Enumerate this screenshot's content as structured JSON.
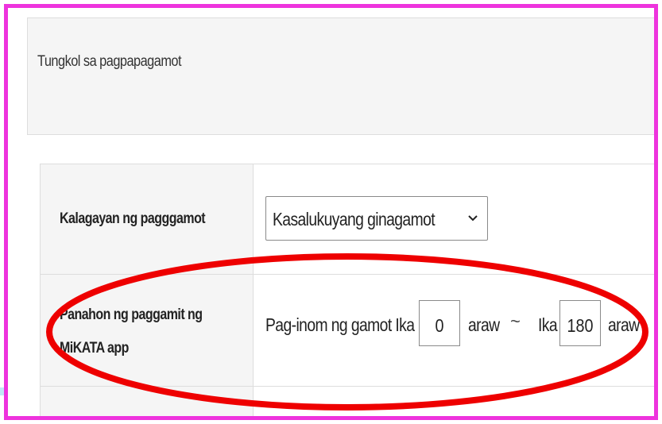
{
  "panel": {
    "title": "Tungkol sa pagpapagamot"
  },
  "rows": [
    {
      "label": "Kalagayan ng pagggamot",
      "select_value": "Kasalukuyang ginagamot"
    },
    {
      "label_line1": "Panahon ng paggamit ng",
      "label_line2": "MiKATA app",
      "prefix": "Pag-inom ng gamot Ika",
      "start_day": "0",
      "unit1": "araw",
      "separator": "~",
      "mid_prefix": "Ika",
      "end_day": "180",
      "unit2": "araw"
    }
  ],
  "colors": {
    "frame": "#ee33dd",
    "highlight_ellipse": "#ee0000",
    "accent_bar": "#bfe9f6"
  },
  "icons": {
    "select_chevron": "chevron-down-icon"
  }
}
